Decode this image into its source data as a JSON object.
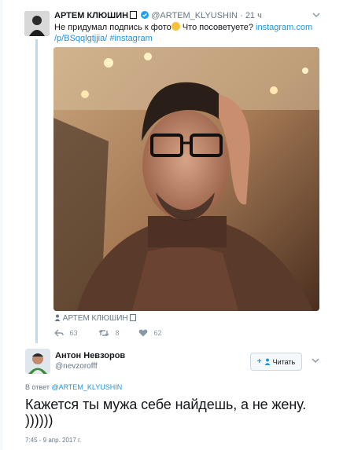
{
  "parent_tweet": {
    "author_name": "АРТЕМ КЛЮШИН",
    "author_handle": "@ARTEM_KLYUSHIN",
    "separator": "·",
    "time": "21 ч",
    "text_before_emoji": "Не придумал подпись к фото",
    "text_after_emoji": " Что посоветуете? ",
    "link_text_1": "instagram.com",
    "link_text_2": "/p/BSqqlgtjjia/",
    "hashtag": "#instagram",
    "photo_tag": "АРТЕМ КЛЮШИН",
    "reply_count": "63",
    "retweet_count": "8",
    "like_count": "62"
  },
  "reply_tweet": {
    "author_name": "Антон Невзоров",
    "author_handle": "@nevzorofff",
    "follow_label": "Читать",
    "in_reply_prefix": "В ответ ",
    "in_reply_handle": "@ARTEM_KLYUSHIN",
    "text_line_1": "Кажется ты мужа себе найдешь, а не жену.",
    "text_line_2": "))))))",
    "timestamp": "7:45 - 9 апр. 2017 г."
  },
  "icons": {
    "verified": "verified-badge-icon",
    "caret": "chevron-down-icon",
    "reply": "reply-icon",
    "retweet": "retweet-icon",
    "like": "heart-icon",
    "person": "person-icon",
    "follow_plus": "plus-icon"
  },
  "colors": {
    "link": "#1b95e0",
    "thread_line": "#b5dcf2",
    "muted_text": "#657786"
  }
}
